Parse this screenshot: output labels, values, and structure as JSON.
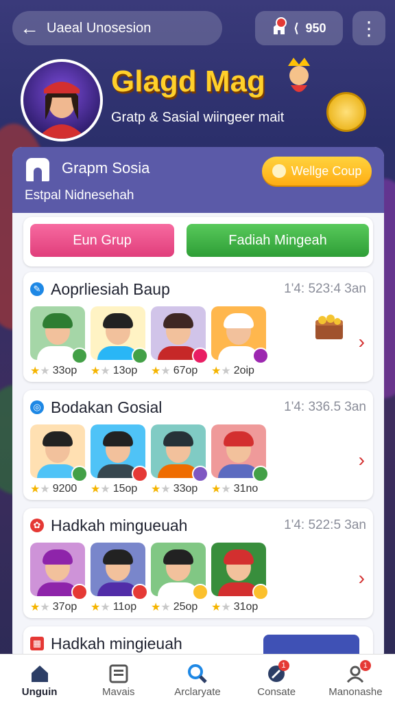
{
  "topbar": {
    "title": "Uaeal Unosesion",
    "status_text": "950",
    "back_icon": "back-arrow-icon",
    "menu_icon": "kebab-icon"
  },
  "hero": {
    "title": "Glagd Mag",
    "subtitle": "Gratp & Sasial wiingeer mait"
  },
  "panel": {
    "name": "Grapm Sosia",
    "subtitle": "Estpal Nidnesehah",
    "coupon_label": "Wellge Coup"
  },
  "actions": {
    "primary": "Eun Grup",
    "secondary": "Fadiah Mingeah"
  },
  "cards": [
    {
      "title": "Aoprliesiah Baup",
      "time": "1'4: 523:4 3an",
      "icon_color": "#1e88e5",
      "items": [
        {
          "score": "33op"
        },
        {
          "score": "13op"
        },
        {
          "score": "67op"
        },
        {
          "score": "2oip"
        }
      ]
    },
    {
      "title": "Bodakan Gosial",
      "time": "1'4: 336.5 3an",
      "icon_color": "#1e88e5",
      "items": [
        {
          "score": "9200"
        },
        {
          "score": "15op"
        },
        {
          "score": "33op"
        },
        {
          "score": "31no"
        }
      ]
    },
    {
      "title": "Hadkah mingueuah",
      "time": "1'4: 522:5 3an",
      "icon_color": "#e53935",
      "items": [
        {
          "score": "37op"
        },
        {
          "score": "11op"
        },
        {
          "score": "25op"
        },
        {
          "score": "31op"
        }
      ]
    },
    {
      "title": "Hadkah mingieuah"
    }
  ],
  "nav": [
    {
      "label": "Unguin",
      "icon": "home-icon"
    },
    {
      "label": "Mavais",
      "icon": "list-icon"
    },
    {
      "label": "Arclaryate",
      "icon": "search-icon"
    },
    {
      "label": "Consate",
      "icon": "edit-icon",
      "badge": "1"
    },
    {
      "label": "Manonashe",
      "icon": "user-icon",
      "badge": "1"
    }
  ],
  "colors": {
    "accent": "#5b5aa8",
    "pink": "#e03e7b",
    "green": "#2e9e36",
    "gold": "#ffd02b"
  }
}
